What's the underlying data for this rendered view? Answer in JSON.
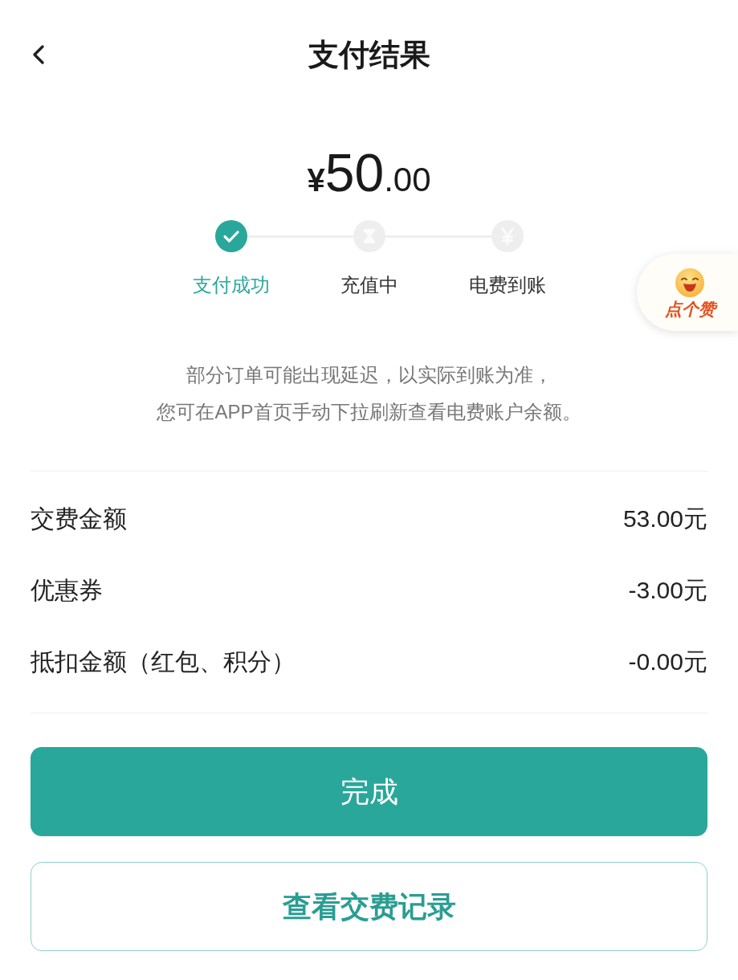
{
  "header": {
    "title": "支付结果"
  },
  "amount": {
    "currency": "¥",
    "integer": "50",
    "decimal": ".00"
  },
  "steps": [
    {
      "label": "支付成功",
      "done": true
    },
    {
      "label": "充值中",
      "done": false
    },
    {
      "label": "电费到账",
      "done": false
    }
  ],
  "notice": [
    "部分订单可能出现延迟，以实际到账为准，",
    "您可在APP首页手动下拉刷新查看电费账户余额。"
  ],
  "details": [
    {
      "label": "交费金额",
      "value": "53.00元"
    },
    {
      "label": "优惠券",
      "value": "-3.00元"
    },
    {
      "label": "抵扣金额（红包、积分）",
      "value": "-0.00元"
    }
  ],
  "buttons": [
    {
      "label": "完成",
      "kind": "primary"
    },
    {
      "label": "查看交费记录",
      "kind": "outline"
    }
  ],
  "like_badge": {
    "label": "点个赞"
  }
}
